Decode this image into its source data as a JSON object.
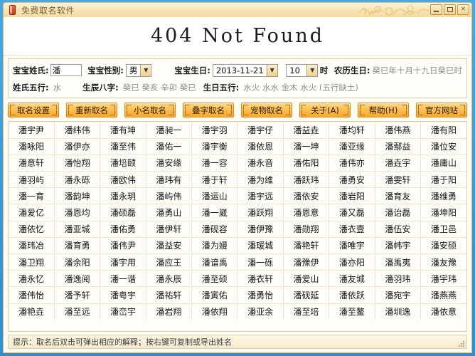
{
  "window": {
    "title": "免费取名软件",
    "icon": "app-book-icon",
    "controls": {
      "minimize": "–",
      "maximize": "□",
      "close": "×"
    }
  },
  "banner": {
    "text": "404 Not Found"
  },
  "form": {
    "surname_label": "宝宝姓氏:",
    "surname_value": "潘",
    "gender_label": "宝宝性别:",
    "gender_value": "男",
    "birthday_label": "宝宝生日:",
    "birthday_value": "2013-11-21",
    "hour_value": "10",
    "hour_unit": "时",
    "lunar_label": "农历生日:",
    "lunar_value": "癸巳年十月十九日癸巳时",
    "surname_wuxing_label": "姓氏五行:",
    "surname_wuxing_value": "水",
    "bazi_label": "生辰八字:",
    "bazi_value": "癸巳 癸亥 辛卯 癸巳",
    "birth_wuxing_label": "生日五行:",
    "birth_wuxing_value": "水火 水水 金木 水火 (五行缺土)"
  },
  "toolbar": {
    "buttons": [
      {
        "label": "取名设置"
      },
      {
        "label": "重新取名"
      },
      {
        "label": "小名取名"
      },
      {
        "label": "叠字取名"
      },
      {
        "label": "宠物取名"
      }
    ],
    "right_buttons": [
      {
        "label": "关于(A)"
      },
      {
        "label": "帮助(H)"
      },
      {
        "label": "官方网站"
      }
    ]
  },
  "names_grid": {
    "rows": [
      [
        "潘宇尹",
        "潘纬伟",
        "潘有坤",
        "潘昶一",
        "潘宇羽",
        "潘宇仔",
        "潘益垚",
        "潘均轩",
        "潘伟燕",
        "潘有阳"
      ],
      [
        "潘咏阳",
        "潘伊亦",
        "潘至伟",
        "潘佑一",
        "潘宇衡",
        "潘依恩",
        "潘一坤",
        "潘亚缘",
        "潘鄢益",
        "潘位安"
      ],
      [
        "潘意轩",
        "潘怡翔",
        "潘培颐",
        "潘安缘",
        "潘一容",
        "潘永音",
        "潘佑阳",
        "潘伟亦",
        "潘垚宇",
        "潘庸山"
      ],
      [
        "潘羽屿",
        "潘永砾",
        "潘欧伟",
        "潘玮有",
        "潘于轩",
        "潘为维",
        "潘跃玮",
        "潘勇安",
        "潘雯轩",
        "潘于阳"
      ],
      [
        "潘一育",
        "潘韵坤",
        "潘永玥",
        "潘屿伟",
        "潘运山",
        "潘宇远",
        "潘依安",
        "潘岩阳",
        "潘育友",
        "潘维勇"
      ],
      [
        "潘爱亿",
        "潘恩均",
        "潘硕磊",
        "潘勇山",
        "潘一崴",
        "潘跃翔",
        "潘恩意",
        "潘又磊",
        "潘诒磊",
        "潘坤阳"
      ],
      [
        "潘依忆",
        "潘亚城",
        "潘佑勇",
        "潘伊轩",
        "潘砚容",
        "潘伊豫",
        "潘勋翔",
        "潘衣壹",
        "潘伍安",
        "潘卫邑"
      ],
      [
        "潘玮冶",
        "潘育勇",
        "潘伟尹",
        "潘益安",
        "潘为嫚",
        "潘瑷城",
        "潘艳轩",
        "潘唯宇",
        "潘帏宇",
        "潘安硕"
      ],
      [
        "潘卫翔",
        "潘余阳",
        "潘宇用",
        "潘应王",
        "潘谙禹",
        "潘一砾",
        "潘豫伊",
        "潘亦阳",
        "潘禹夷",
        "潘友豫"
      ],
      [
        "潘永忆",
        "潘逸阅",
        "潘一谐",
        "潘永辰",
        "潘至硕",
        "潘衣轩",
        "潘爱山",
        "潘友城",
        "潘羽玮",
        "潘宇玮"
      ],
      [
        "潘伟怡",
        "潘予轩",
        "潘粤宇",
        "潘祐轩",
        "潘寅佑",
        "潘勇怡",
        "潘砚延",
        "潘依跃",
        "潘宛宇",
        "潘燕燕"
      ],
      [
        "潘艳垚",
        "潘至远",
        "潘峦宇",
        "潘岩翔",
        "潘依翔",
        "潘亚余",
        "潘至培",
        "潘至鳌",
        "潘圳逸",
        "潘依意"
      ]
    ]
  },
  "statusbar": {
    "hint": "提示：取名后双击可弹出相应的解释；按右键可复制或导出姓名"
  },
  "colors": {
    "window_frame": "#3c9ad8",
    "title_gradient_top": "#fdf4da",
    "title_gradient_bottom": "#f3dca2",
    "button_orange": "#f7a82e",
    "panel_border": "#e3cf9c",
    "grid_line": "#efe6cf"
  }
}
